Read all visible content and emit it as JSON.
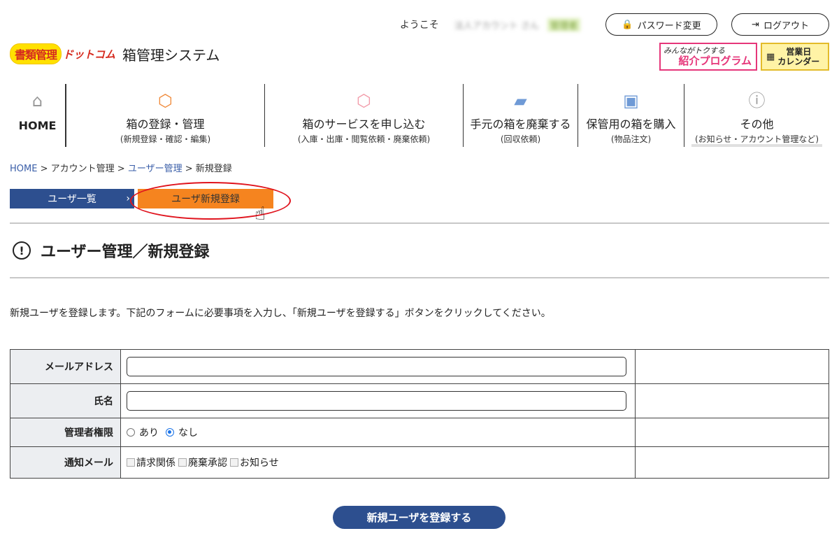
{
  "header": {
    "welcome": "ようこそ",
    "account_name": "法人アカウント",
    "account_suffix": "さん",
    "role_badge": "管理者",
    "password_button": "パスワード変更",
    "logout_button": "ログアウト"
  },
  "logo": {
    "mark": "書類管理",
    "dotcom": "ドットコム",
    "system_name": "箱管理システム"
  },
  "promo": {
    "small": "みんながトクする",
    "big": "紹介プログラム"
  },
  "calendar": {
    "line1": "営業日",
    "line2": "カレンダー"
  },
  "nav": {
    "home": "HOME",
    "items": [
      {
        "title": "箱の登録・管理",
        "sub": "(新規登録・確認・編集)",
        "icon": "box-icon",
        "color": "#f08a3a"
      },
      {
        "title": "箱のサービスを申し込む",
        "sub": "(入庫・出庫・閲覧依頼・廃棄依頼)",
        "icon": "box-service-icon",
        "color": "#f29aa8"
      },
      {
        "title": "手元の箱を廃棄する",
        "sub": "(回収依頼)",
        "icon": "truck-icon",
        "color": "#6f9ad6"
      },
      {
        "title": "保管用の箱を購入",
        "sub": "(物品注文)",
        "icon": "box-purchase-icon",
        "color": "#6f9ad6"
      },
      {
        "title": "その他",
        "sub": "(お知らせ・アカウント管理など)",
        "icon": "info-icon",
        "color": "#999999"
      }
    ]
  },
  "breadcrumb": {
    "home": "HOME",
    "sep": ">",
    "account": "アカウント管理",
    "users": "ユーザー管理",
    "current": "新規登録"
  },
  "subtabs": {
    "list": "ユーザ一覧",
    "list_chevron": "›",
    "new": "ユーザ新規登録"
  },
  "page": {
    "title": "ユーザー管理／新規登録",
    "description": "新規ユーザを登録します。下記のフォームに必要事項を入力し、「新規ユーザを登録する」ボタンをクリックしてください。"
  },
  "form": {
    "email_label": "メールアドレス",
    "email_value": "",
    "name_label": "氏名",
    "name_value": "",
    "admin_label": "管理者権限",
    "admin_yes": "あり",
    "admin_no": "なし",
    "admin_selected": "なし",
    "notify_label": "通知メール",
    "notify_options": [
      "請求関係",
      "廃棄承認",
      "お知らせ"
    ]
  },
  "submit_button": "新規ユーザを登録する"
}
